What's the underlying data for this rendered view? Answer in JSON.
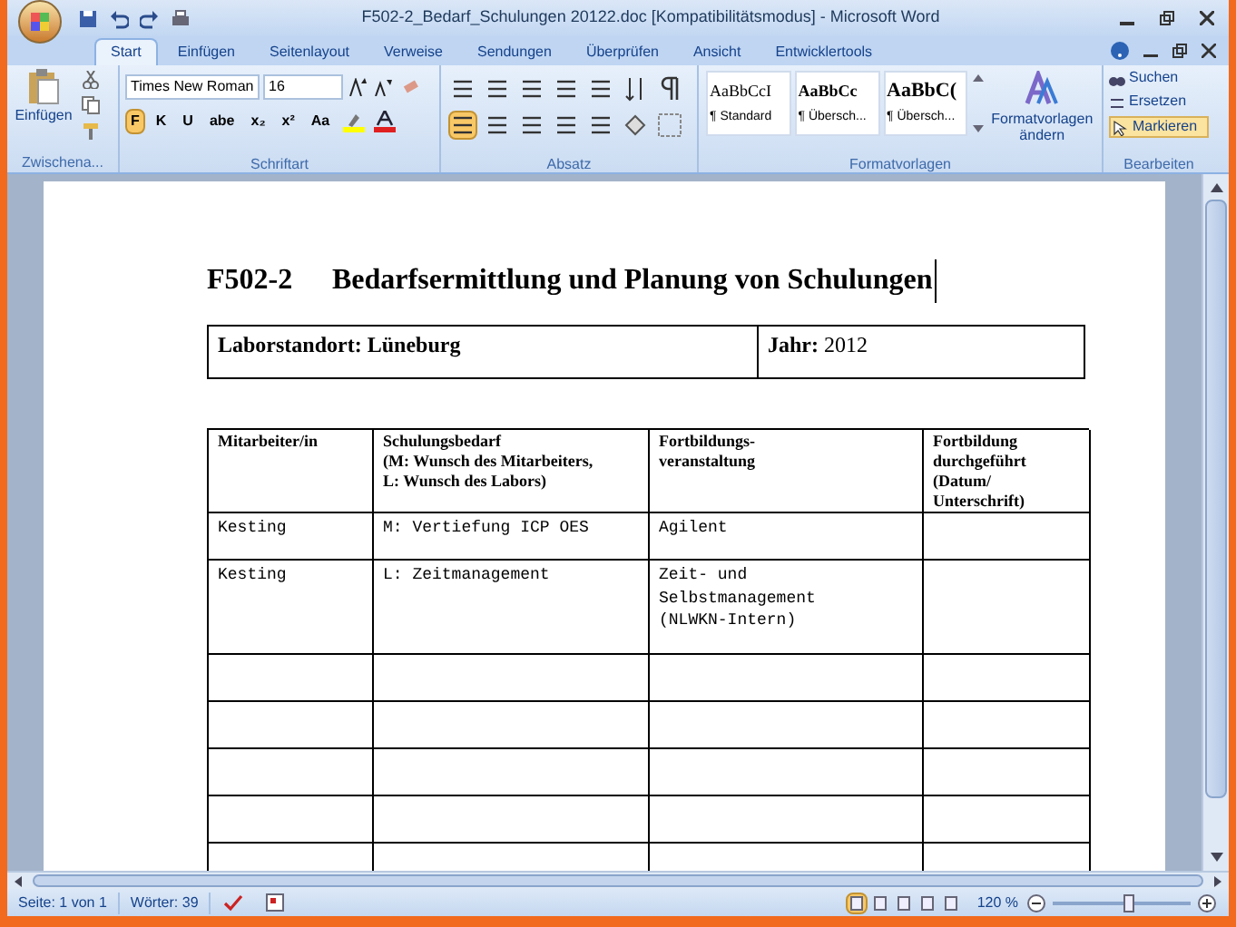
{
  "window": {
    "title": "F502-2_Bedarf_Schulungen 20122.doc [Kompatibilitätsmodus] - Microsoft Word"
  },
  "tabs": [
    {
      "label": "Start",
      "selected": true
    },
    {
      "label": "Einfügen",
      "selected": false
    },
    {
      "label": "Seitenlayout",
      "selected": false
    },
    {
      "label": "Verweise",
      "selected": false
    },
    {
      "label": "Sendungen",
      "selected": false
    },
    {
      "label": "Überprüfen",
      "selected": false
    },
    {
      "label": "Ansicht",
      "selected": false
    },
    {
      "label": "Entwicklertools",
      "selected": false
    }
  ],
  "ribbon": {
    "clipboard": {
      "paste": "Einfügen",
      "label": "Zwischena..."
    },
    "font": {
      "name": "Times New Roman",
      "size": "16",
      "format_buttons": [
        {
          "text": "F",
          "selected": true
        },
        {
          "text": "K",
          "selected": false
        },
        {
          "text": "U",
          "selected": false
        },
        {
          "text": "abe",
          "selected": false
        },
        {
          "text": "x₂",
          "selected": false
        },
        {
          "text": "x²",
          "selected": false
        },
        {
          "text": "Aa",
          "selected": false
        }
      ],
      "label": "Schriftart"
    },
    "paragraph": {
      "alignments": [
        {
          "selected": true
        },
        {
          "selected": false
        },
        {
          "selected": false
        },
        {
          "selected": false
        }
      ],
      "label": "Absatz"
    },
    "styles": {
      "items": [
        {
          "sample": "AaBbCcI",
          "name": "¶ Standard",
          "kind": "normal"
        },
        {
          "sample": "AaBbCc",
          "name": "¶ Übersch...",
          "kind": "heading1"
        },
        {
          "sample": "AaBbC(",
          "name": "¶ Übersch...",
          "kind": "heading2"
        }
      ],
      "change": "Formatvorlagen ändern",
      "label": "Formatvorlagen"
    },
    "editing": {
      "find": "Suchen",
      "replace": "Ersetzen",
      "select": "Markieren",
      "label": "Bearbeiten"
    }
  },
  "document": {
    "code": "F502-2",
    "title": "Bedarfsermittlung und Planung von Schulungen",
    "info": [
      {
        "text": "Laborstandort: Lüneburg"
      },
      {
        "text": "**Jahr:** 2012"
      }
    ],
    "table": {
      "columns": [
        [
          "Mitarbeiter/in"
        ],
        [
          "Schulungsbedarf",
          "(M: Wunsch des Mitarbeiters,",
          "L: Wunsch des Labors)"
        ],
        [
          "Fortbildungs-",
          "veranstaltung"
        ],
        [
          "Fortbildung",
          "durchgeführt",
          "(Datum/",
          "Unterschrift)"
        ]
      ],
      "rows": [
        {
          "kind": "filled",
          "cells": [
            "Kesting",
            "M: Vertiefung ICP OES",
            "Agilent"
          ]
        },
        {
          "kind": "filled",
          "cells": [
            "Kesting",
            "L: Zeitmanagement",
            "Zeit- und\nSelbstmanagement\n(NLWKN-Intern)"
          ]
        },
        {
          "kind": "blank"
        },
        {
          "kind": "blank"
        },
        {
          "kind": "blank"
        },
        {
          "kind": "blank"
        },
        {
          "kind": "blank"
        }
      ]
    }
  },
  "status_bar": {
    "page": "Seite: 1 von 1",
    "words": "Wörter: 39",
    "views": [
      {
        "selected": true
      },
      {
        "selected": false
      },
      {
        "selected": false
      },
      {
        "selected": false
      },
      {
        "selected": false
      }
    ],
    "zoom": "120 %",
    "zoom_level": {
      "level": 0.55
    }
  }
}
